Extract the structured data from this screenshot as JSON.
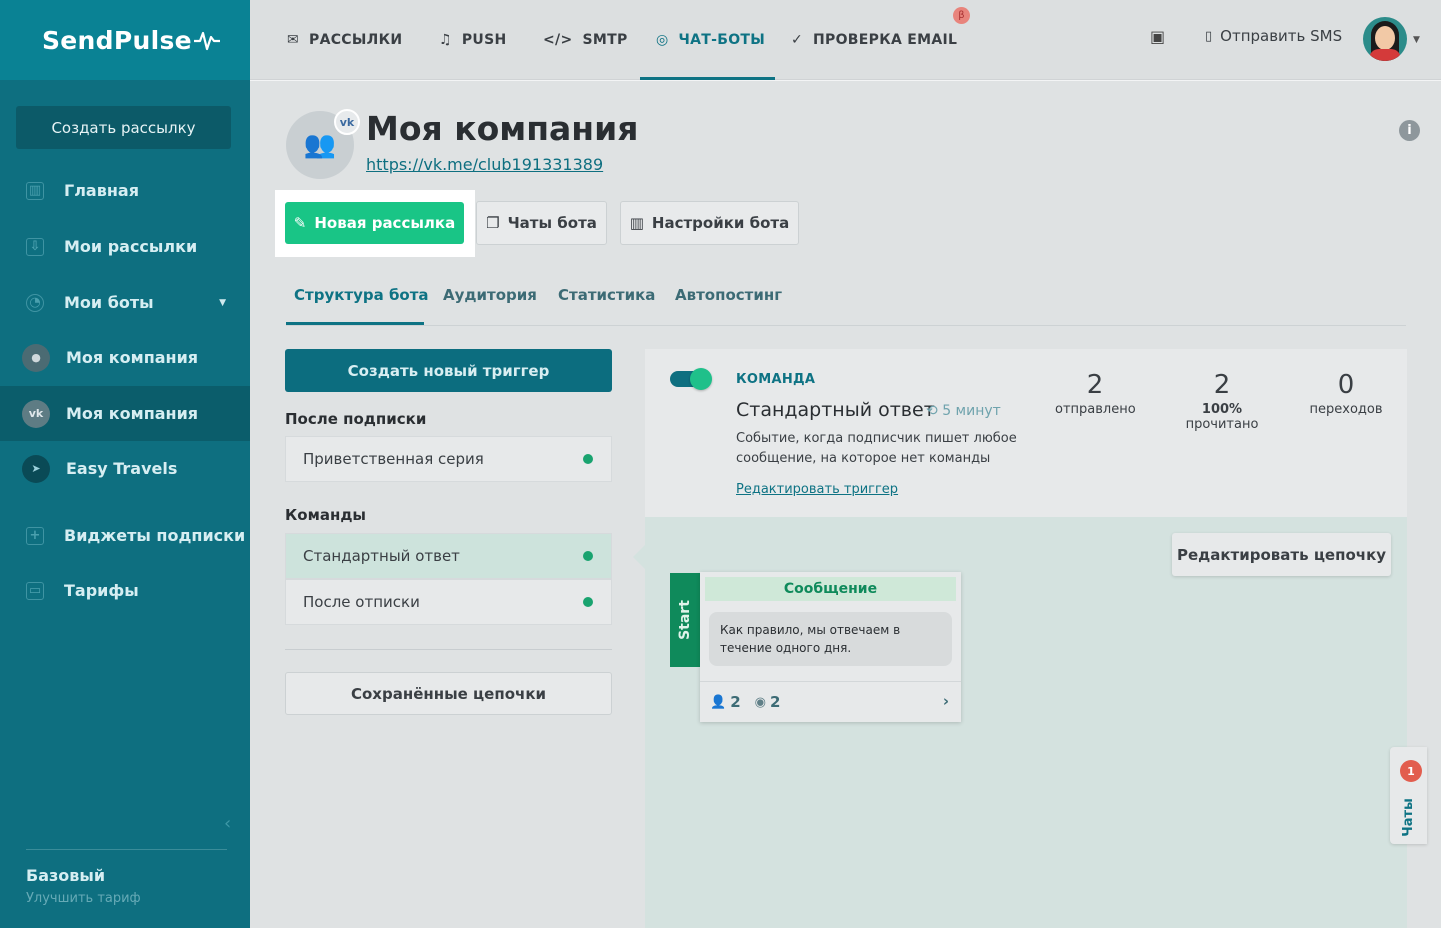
{
  "sidebar": {
    "logo": "SendPulse",
    "create_button": "Создать рассылку",
    "items": [
      {
        "label": "Главная",
        "icon": "dashboard-icon"
      },
      {
        "label": "Мои рассылки",
        "icon": "mailbox-icon"
      },
      {
        "label": "Мои боты",
        "icon": "bot-icon"
      },
      {
        "label": "Моя компания",
        "icon": "messenger-avatar-icon"
      },
      {
        "label": "Моя компания",
        "icon": "vk-avatar-icon"
      },
      {
        "label": "Easy Travels",
        "icon": "telegram-avatar-icon"
      },
      {
        "label": "Виджеты подписки",
        "icon": "widget-icon"
      },
      {
        "label": "Тарифы",
        "icon": "wallet-icon"
      }
    ],
    "plan_name": "Базовый",
    "plan_upgrade": "Улучшить тариф"
  },
  "topbar": {
    "tabs": [
      {
        "label": "РАССЫЛКИ",
        "icon": "mail-icon"
      },
      {
        "label": "PUSH",
        "icon": "bell-icon"
      },
      {
        "label": "SMTP",
        "icon": "code-icon"
      },
      {
        "label": "ЧАТ-БОТЫ",
        "icon": "chat-icon"
      },
      {
        "label": "ПРОВЕРКА EMAIL",
        "icon": "check-circle-icon"
      }
    ],
    "beta_badge": "β",
    "sms_label": "Отправить SMS"
  },
  "bot": {
    "title": "Моя компания",
    "link": "https://vk.me/club191331389",
    "network_badge": "vk"
  },
  "actions": {
    "new_mailing": "Новая рассылка",
    "bot_chats": "Чаты бота",
    "bot_settings": "Настройки бота"
  },
  "subtabs": [
    "Структура бота",
    "Аудитория",
    "Статистика",
    "Автопостинг"
  ],
  "left": {
    "create_trigger": "Создать новый триггер",
    "after_subscribe_label": "После подписки",
    "after_subscribe_items": [
      "Приветственная серия"
    ],
    "commands_label": "Команды",
    "command_items": [
      "Стандартный ответ",
      "После отписки"
    ],
    "saved_chains": "Сохранённые цепочки"
  },
  "trigger": {
    "type_label": "КОМАНДА",
    "title": "Стандартный ответ",
    "delay": "5 минут",
    "description": "Событие, когда подписчик пишет любое сообщение, на которое нет команды",
    "edit_link": "Редактировать триггер",
    "stats": [
      {
        "value": "2",
        "label": "отправлено",
        "pct": ""
      },
      {
        "value": "2",
        "label": "прочитано",
        "pct": "100%"
      },
      {
        "value": "0",
        "label": "переходов",
        "pct": ""
      }
    ]
  },
  "canvas": {
    "edit_chain": "Редактировать цепочку",
    "start_label": "Start",
    "message_card": {
      "header": "Сообщение",
      "text": "Как правило, мы отвечаем в течение одного дня.",
      "subscribers": "2",
      "views": "2"
    }
  },
  "chats_widget": {
    "label": "Чаты",
    "count": "1"
  },
  "colors": {
    "sidebar": "#0e6f80",
    "accent_green": "#19c586",
    "accent_teal": "#0e7384"
  }
}
